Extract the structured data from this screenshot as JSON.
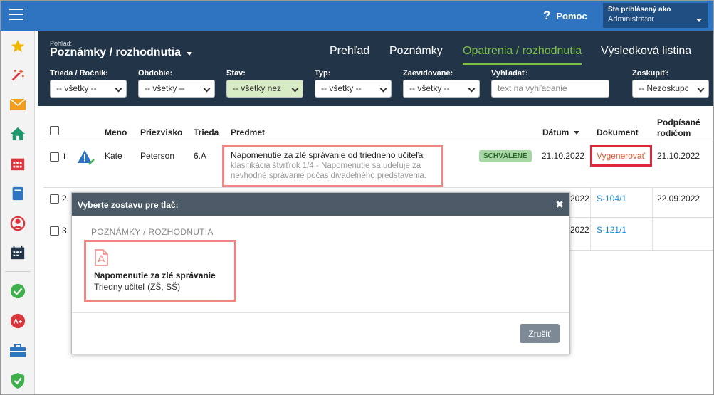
{
  "topbar": {
    "help_label": "Pomoc",
    "help_glyph": "?",
    "user_line1": "Ste prihlásený ako",
    "user_line2": "Administrátor",
    "bg_color": "#2e74c0"
  },
  "header": {
    "view_label": "Pohľad:",
    "view_title": "Poznámky / rozhodnutia",
    "tabs": [
      {
        "label": "Prehľad"
      },
      {
        "label": "Poznámky"
      },
      {
        "label": "Opatrenia / rozhodnutia"
      },
      {
        "label": "Výsledková listina"
      }
    ],
    "active_tab": "Opatrenia / rozhodnutia",
    "filters": [
      {
        "label": "Trieda / Ročník:",
        "value": "-- všetky --"
      },
      {
        "label": "Obdobie:",
        "value": "-- všetky --"
      },
      {
        "label": "Stav:",
        "value": "-- všetky nez"
      },
      {
        "label": "Typ:",
        "value": "-- všetky --"
      },
      {
        "label": "Zaevidované:",
        "value": "-- všetky --"
      },
      {
        "label": "Vyhľadať:",
        "placeholder": "text na vyhľadanie"
      },
      {
        "label": "Zoskupiť:",
        "value": "-- Nezoskupc"
      }
    ]
  },
  "sidebar": {
    "icons": [
      "star-icon",
      "magic-wand-icon",
      "mail-icon",
      "home-icon",
      "calendar-icon",
      "book-icon",
      "person-icon",
      "schedule-icon",
      "check-icon",
      "grade-icon",
      "briefcase-icon",
      "shield-icon"
    ]
  },
  "table": {
    "headers": {
      "meno": "Meno",
      "priezvisko": "Priezvisko",
      "trieda": "Trieda",
      "predmet": "Predmet",
      "datum": "Dátum",
      "dokument": "Dokument",
      "podpisane_1": "Podpísané",
      "podpisane_2": "rodičom"
    },
    "rows": [
      {
        "num": "1.",
        "meno": "Kate",
        "priezvisko": "Peterson",
        "trieda": "6.A",
        "predmet_title": "Napomenutie za zlé správanie od triedneho učiteľa",
        "predmet_desc": "klasifikácia štvrťrok 1/4 - Napomenutie sa udeľuje za nevhodné správanie počas divadelného predstavenia.",
        "status": "SCHVÁLENÉ",
        "datum": "21.10.2022",
        "dokument": "Vygenerovať",
        "podpisane": "21.10.2022"
      },
      {
        "num": "2.",
        "datum_partial": "2022",
        "dokument": "S-104/1",
        "podpisane": "22.09.2022"
      },
      {
        "num": "3.",
        "datum_partial": "2022",
        "dokument": "S-121/1",
        "podpisane": ""
      }
    ]
  },
  "modal": {
    "title": "Vyberte zostavu pre tlač:",
    "close_glyph": "✖",
    "section": "POZNÁMKY / ROZHODNUTIA",
    "report_title": "Napomenutie za zlé správanie",
    "report_subtitle": "Triedny učiteľ (ZŠ, SŠ)",
    "cancel_label": "Zrušiť"
  }
}
